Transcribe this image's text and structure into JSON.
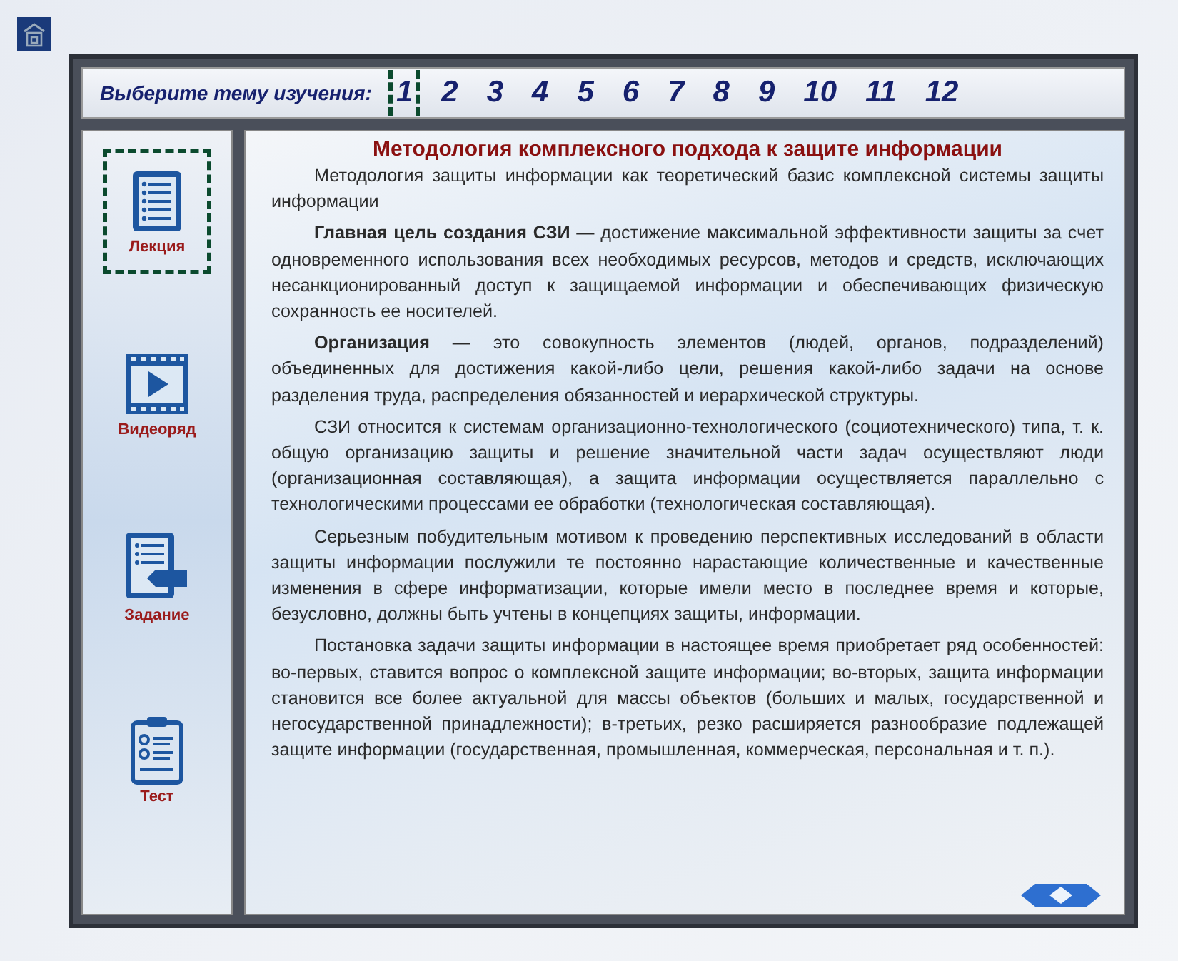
{
  "topic_bar": {
    "label": "Выберите тему изучения:",
    "topics": [
      {
        "label": "1",
        "selected": true
      },
      {
        "label": "2",
        "selected": false
      },
      {
        "label": "3",
        "selected": false
      },
      {
        "label": "4",
        "selected": false
      },
      {
        "label": "5",
        "selected": false
      },
      {
        "label": "6",
        "selected": false
      },
      {
        "label": "7",
        "selected": false
      },
      {
        "label": "8",
        "selected": false
      },
      {
        "label": "9",
        "selected": false
      },
      {
        "label": "10",
        "selected": false
      },
      {
        "label": "11",
        "selected": false
      },
      {
        "label": "12",
        "selected": false
      }
    ]
  },
  "sidebar": {
    "items": [
      {
        "kind": "lecture",
        "label": "Лекция",
        "selected": true
      },
      {
        "kind": "video",
        "label": "Видеоряд",
        "selected": false
      },
      {
        "kind": "task",
        "label": "Задание",
        "selected": false
      },
      {
        "kind": "test",
        "label": "Тест",
        "selected": false
      }
    ]
  },
  "content": {
    "title": "Методология комплексного подхода к защите информации",
    "paragraphs": [
      "Методология защиты информации как теоретический базис комплексной системы защиты информации",
      "**Главная цель создания СЗИ** — достижение максимальной эффективности защиты за счет одновременного использования всех необходимых ресурсов, методов и средств, исключающих несанкционированный доступ к защищаемой информации и обеспечивающих физическую сохранность ее носителей.",
      "**Организация** — это совокупность элементов (людей, органов, подразделений) объединенных для достижения какой-либо цели, решения какой-либо задачи на основе разделения труда, распределения обязанностей и иерархической структуры.",
      "СЗИ относится к системам организационно-технологического (социотехнического) типа, т. к. общую организацию защиты и решение значительной части задач осуществляют люди (организационная составляющая), а защита информации осуществляется параллельно с технологическими процессами ее обработки (технологическая составляющая).",
      "Серьезным побудительным мотивом к проведению перспективных исследований в области защиты информации послужили те постоянно нарастающие количественные и качественные изменения в сфере информатизации, которые имели место в последнее время и которые, безусловно, должны быть учтены в концепциях защиты, информации.",
      "Постановка задачи защиты информации в настоящее время приобретает ряд особенностей: во-первых, ставится вопрос о комплексной защите информации; во-вторых, защита информации становится все более актуальной для массы объектов (больших и малых, государственной и негосударственной принадлежности); в-третьих, резко расширяется разнообразие подлежащей защите информации (государственная, промышленная, коммерческая, персональная и т. п.)."
    ]
  }
}
